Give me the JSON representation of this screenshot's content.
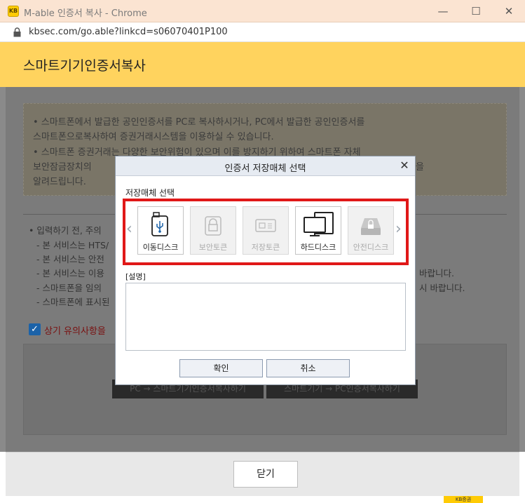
{
  "window": {
    "app_icon_text": "KB",
    "title": "M-able 인증서 복사 - Chrome",
    "min_symbol": "—",
    "max_symbol": "☐",
    "close_symbol": "✕"
  },
  "address_bar": {
    "url": "kbsec.com/go.able?linkcd=s06070401P100"
  },
  "page": {
    "title": "스마트기기인증서복사",
    "notice_lines": [
      "• 스마트폰에서 발급한 공인인증서를 PC로 복사하시거나, PC에서 발급한 공인인증서를",
      "  스마트폰으로복사하여 증권거래시스템을 이용하실 수 있습니다.",
      "• 스마트폰 증권거래는 다양한 보안위험이 있으며 이를 방지하기 위하여 스마트폰 자체",
      "  보안잠금장치의",
      "  알려드립니다."
    ],
    "notice_tail": "을",
    "bullets": [
      "• 입력하기 전, 주의",
      "- 본 서비스는 HTS/",
      "- 본 서비스는 안전",
      "- 본 서비스는 이용",
      "- 스마트폰을 임의",
      "- 스마트폰에 표시된"
    ],
    "bullet_tails": [
      "바랍니다.",
      "시 바랍니다."
    ],
    "agree_check": "✓",
    "agree_text": "상기 유의사항을",
    "action_buttons": [
      "PC → 스마트기기인증서복사하기",
      "스마트기기 → PC인증서복사하기"
    ],
    "close_button": "닫기",
    "kb_badge": "KB증권"
  },
  "dialog": {
    "title": "인증서 저장매체 선택",
    "close_symbol": "✕",
    "media_section_label": "저장매체 선택",
    "prev_arrow": "‹",
    "next_arrow": "›",
    "media": [
      {
        "label": "이동디스크",
        "icon": "usb-drive-icon",
        "enabled": true
      },
      {
        "label": "보안토큰",
        "icon": "security-token-icon",
        "enabled": false
      },
      {
        "label": "저장토큰",
        "icon": "storage-token-icon",
        "enabled": false
      },
      {
        "label": "하드디스크",
        "icon": "computer-monitor-icon",
        "enabled": true
      },
      {
        "label": "안전디스크",
        "icon": "secure-disk-icon",
        "enabled": false
      }
    ],
    "description_label": "[설명]",
    "description_text": "",
    "confirm_button": "확인",
    "cancel_button": "취소"
  },
  "colors": {
    "titlebar": "#fbe4d2",
    "header": "#ffd35e",
    "highlight_border": "#e01818",
    "checkbox": "#1b62a8"
  }
}
